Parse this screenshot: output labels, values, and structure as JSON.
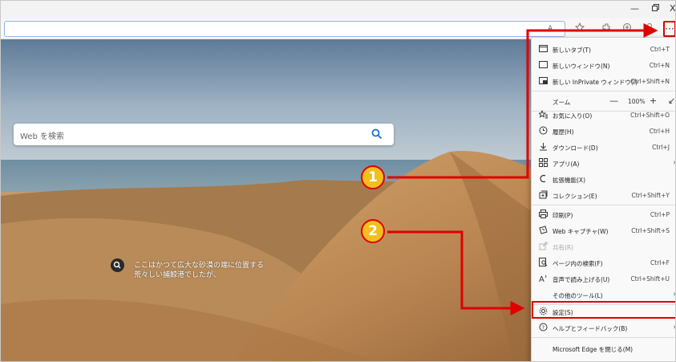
{
  "window": {
    "minimize": "—",
    "restore": "ᗝ",
    "close": "X"
  },
  "toolbar": {
    "more_label": "···"
  },
  "newtab": {
    "search_placeholder": "Web を検索",
    "caption_line1": "ここはかつて広大な砂漠の端に位置する",
    "caption_line2": "荒々しい捕鯨港でしたが、"
  },
  "menu": {
    "items": [
      {
        "label": "新しいタブ(T)",
        "shortcut": "Ctrl+T",
        "icon": "new-tab-icon"
      },
      {
        "label": "新しいウィンドウ(N)",
        "shortcut": "Ctrl+N",
        "icon": "new-window-icon"
      },
      {
        "label": "新しい InPrivate ウィンドウ(I)",
        "shortcut": "Ctrl+Shift+N",
        "icon": "inprivate-icon"
      },
      {
        "label": "ズーム",
        "zoom_minus": "—",
        "zoom_value": "100%",
        "zoom_plus": "+",
        "zoom_full": "↙"
      },
      {
        "label": "お気に入り(O)",
        "shortcut": "Ctrl+Shift+O",
        "icon": "favorites-icon"
      },
      {
        "label": "履歴(H)",
        "shortcut": "Ctrl+H",
        "icon": "history-icon"
      },
      {
        "label": "ダウンロード(D)",
        "shortcut": "Ctrl+J",
        "icon": "download-icon"
      },
      {
        "label": "アプリ(A)",
        "shortcut": "",
        "icon": "apps-icon"
      },
      {
        "label": "拡張機能(X)",
        "shortcut": "",
        "icon": "extensions-icon"
      },
      {
        "label": "コレクション(E)",
        "shortcut": "Ctrl+Shift+Y",
        "icon": "collections-icon"
      },
      {
        "label": "印刷(P)",
        "shortcut": "Ctrl+P",
        "icon": "print-icon"
      },
      {
        "label": "Web キャプチャ(W)",
        "shortcut": "Ctrl+Shift+S",
        "icon": "web-capture-icon"
      },
      {
        "label": "共有(R)",
        "shortcut": "",
        "icon": "share-icon"
      },
      {
        "label": "ページ内の検索(F)",
        "shortcut": "Ctrl+F",
        "icon": "find-icon"
      },
      {
        "label": "音声で読み上げる(U)",
        "shortcut": "Ctrl+Shift+U",
        "icon": "read-aloud-icon"
      },
      {
        "label": "その他のツール(L)",
        "shortcut": "",
        "icon": ""
      },
      {
        "label": "設定(S)",
        "shortcut": "",
        "icon": "settings-icon"
      },
      {
        "label": "ヘルプとフィードバック(B)",
        "shortcut": "",
        "icon": "help-icon"
      },
      {
        "label": "Microsoft Edge を閉じる(M)",
        "shortcut": "",
        "icon": ""
      }
    ]
  },
  "annotations": {
    "step1": "1",
    "step2": "2",
    "color_accent": "#e00000",
    "color_badge": "#f2bf1d"
  }
}
